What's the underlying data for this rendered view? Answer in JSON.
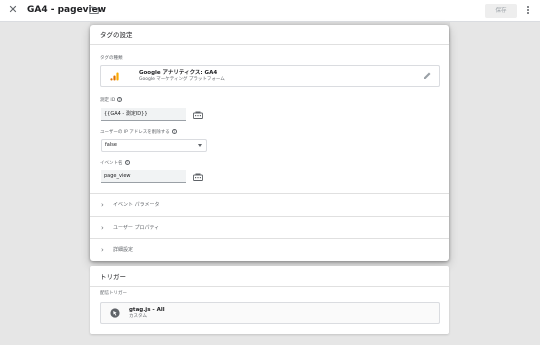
{
  "header": {
    "title": "GA4 - pageview",
    "save_label": "保存"
  },
  "tag_config": {
    "title": "タグの設定",
    "tag_type_label": "タグの種類",
    "tag_type_name": "Google アナリティクス: GA4",
    "tag_type_sub": "Google マーケティング プラットフォーム",
    "measurement_id_label": "測定 ID",
    "measurement_id_value": "{{GA4 - 測定ID}}",
    "ip_label": "ユーザーの IP アドレスを削除する",
    "ip_value": "false",
    "event_name_label": "イベント名",
    "event_name_value": "page_view",
    "sections": [
      "イベント パラメータ",
      "ユーザー プロパティ",
      "詳細設定"
    ]
  },
  "trigger": {
    "title": "トリガー",
    "firing_label": "配信トリガー",
    "name": "gtag.js - All",
    "sub": "カスタム"
  },
  "colors": {
    "ga_orange": "#f9ab00",
    "ga_dark_orange": "#e37400",
    "trigger_icon": "#5f6368"
  }
}
